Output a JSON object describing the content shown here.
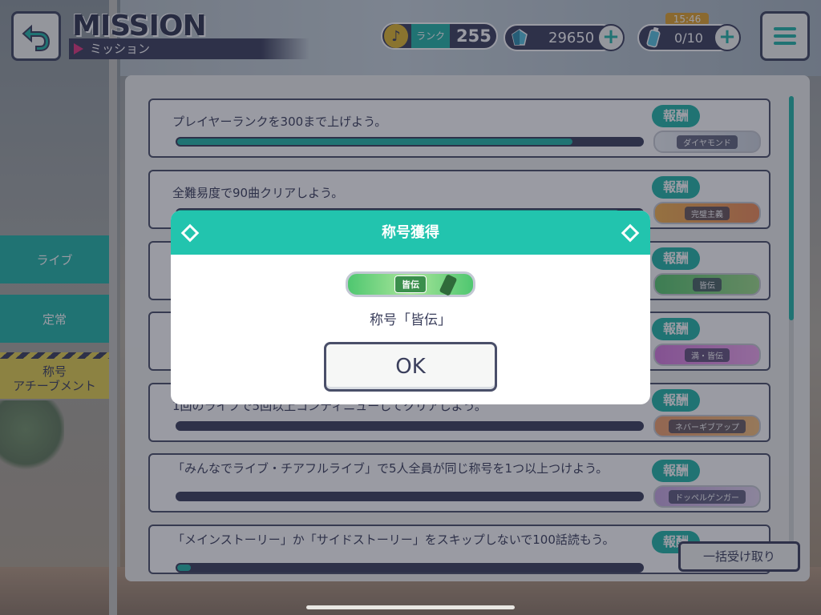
{
  "header": {
    "title": "MISSION",
    "subtitle": "ミッション",
    "rank_label": "ランク",
    "rank_value": "255",
    "gems": "29650",
    "energy": "0/10",
    "timer": "15:46"
  },
  "sidebar": {
    "tabs": [
      {
        "label": "ライブ"
      },
      {
        "label": "定常"
      },
      {
        "label": "称号\nアチーブメント"
      }
    ]
  },
  "missions": [
    {
      "text": "プレイヤーランクを300まで上げよう。",
      "progress": 0.85,
      "reward_label": "報酬",
      "reward_title": "ダイヤモンド"
    },
    {
      "text": "全難易度で90曲クリアしよう。",
      "progress": 0.95,
      "reward_label": "報酬",
      "reward_title": "完璧主義"
    },
    {
      "text": "",
      "progress": 0.0,
      "reward_label": "報酬",
      "reward_title": "皆伝"
    },
    {
      "text": "",
      "progress": 0.0,
      "reward_label": "報酬",
      "reward_title": "満・皆伝"
    },
    {
      "text": "1回のライブで5回以上コンティニューしてクリアしよう。",
      "progress": 0.0,
      "reward_label": "報酬",
      "reward_title": "ネバーギブアップ"
    },
    {
      "text": "「みんなでライブ・チアフルライブ」で5人全員が同じ称号を1つ以上つけよう。",
      "progress": 0.0,
      "reward_label": "報酬",
      "reward_title": "ドッペルゲンガー"
    },
    {
      "text": "「メインストーリー」か「サイドストーリー」をスキップしないで100話読もう。",
      "progress": 0.03,
      "reward_label": "報酬",
      "reward_title": ""
    }
  ],
  "collect_all": "一括受け取り",
  "dialog": {
    "title": "称号獲得",
    "plate_label": "皆伝",
    "message": "称号「皆伝」",
    "ok": "OK"
  },
  "colors": {
    "accent": "#22b7a8",
    "dialog_header": "#22c4ae",
    "navy": "#3b3f5c",
    "pink": "#e2357e"
  }
}
